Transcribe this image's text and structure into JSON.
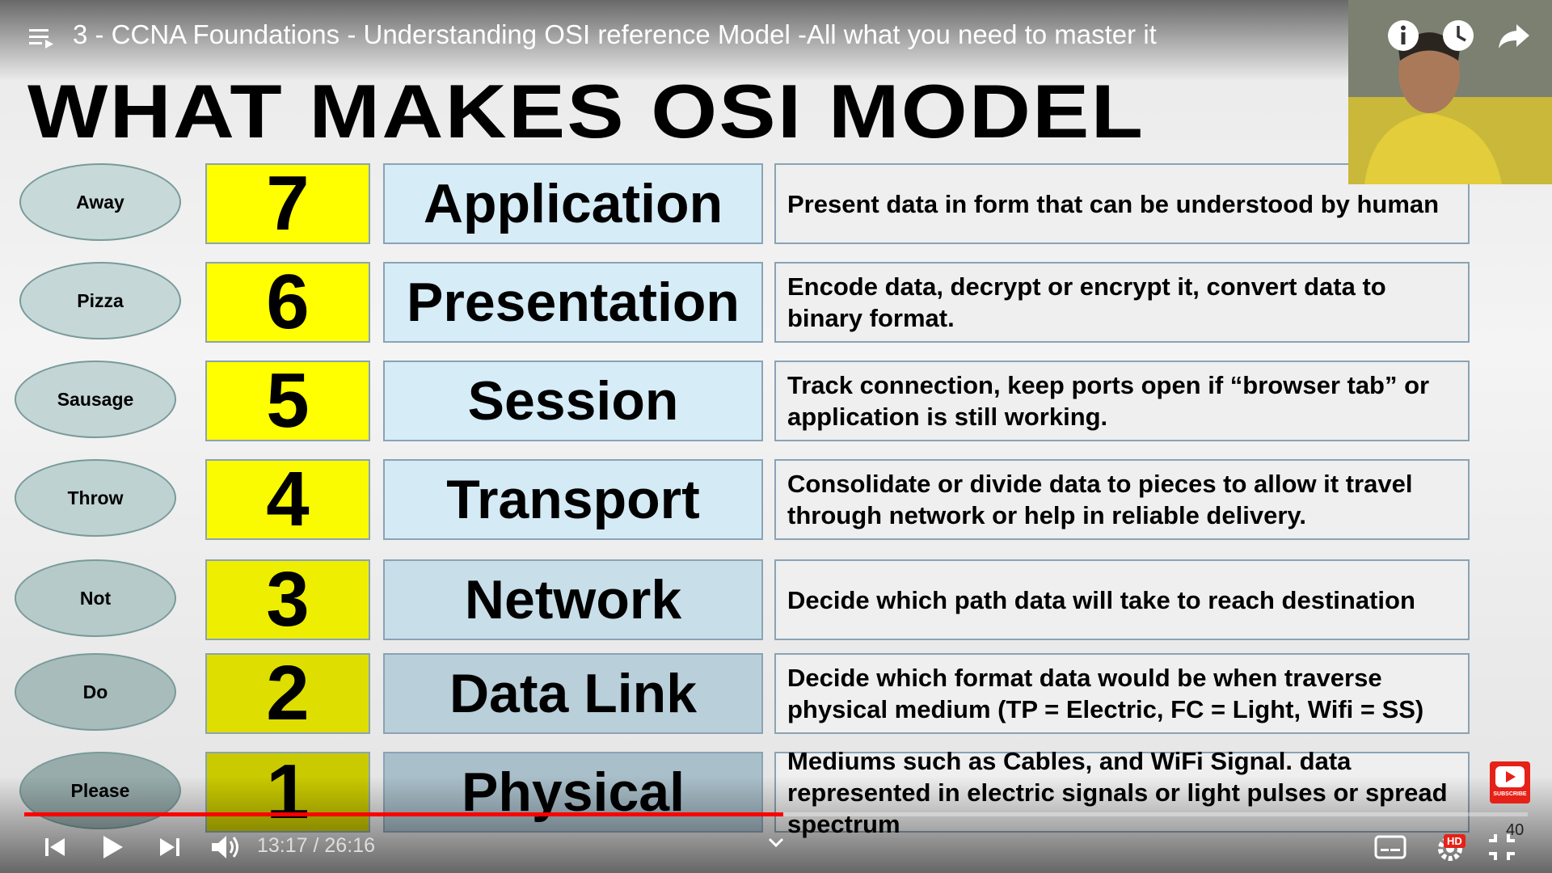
{
  "video": {
    "title": "3 - CCNA Foundations - Understanding OSI reference Model -All what you need to master it",
    "time_current": "13:17",
    "time_separator": " / ",
    "time_total": "26:16",
    "progress_fraction": 0.505,
    "counter": "40",
    "hd_badge": "HD",
    "subscribe_label": "SUBSCRIBE"
  },
  "slide": {
    "heading": "WHAT MAKES OSI MODEL",
    "layers": [
      {
        "mnemonic": "Away",
        "number": "7",
        "name": "Application",
        "description": "Present data in form that can be understood by human",
        "num_color": "#ffff00",
        "name_color": "#d6ecf7",
        "mnem_color": "#c7d9d9"
      },
      {
        "mnemonic": "Pizza",
        "number": "6",
        "name": "Presentation",
        "description": "Encode data, decrypt or encrypt it, convert data to binary format.",
        "num_color": "#ffff00",
        "name_color": "#d6ecf7",
        "mnem_color": "#c5d7d7"
      },
      {
        "mnemonic": "Sausage",
        "number": "5",
        "name": "Session",
        "description": "Track connection, keep ports open if “browser tab” or application is still working.",
        "num_color": "#ffff00",
        "name_color": "#d6ecf7",
        "mnem_color": "#c3d5d5"
      },
      {
        "mnemonic": "Throw",
        "number": "4",
        "name": "Transport",
        "description": "Consolidate or divide data to pieces to allow it travel through network or help in reliable delivery.",
        "num_color": "#fafa00",
        "name_color": "#d4eaf5",
        "mnem_color": "#bfd2d2"
      },
      {
        "mnemonic": "Not",
        "number": "3",
        "name": "Network",
        "description": "Decide which path data will take to reach destination",
        "num_color": "#eeee00",
        "name_color": "#c8dfea",
        "mnem_color": "#b6caca"
      },
      {
        "mnemonic": "Do",
        "number": "2",
        "name": "Data Link",
        "description": "Decide which format data would be when traverse physical medium (TP = Electric, FC = Light, Wifi = SS)",
        "num_color": "#dede00",
        "name_color": "#b9cfda",
        "mnem_color": "#a8bcbc"
      },
      {
        "mnemonic": "Please",
        "number": "1",
        "name": "Physical",
        "description": "Mediums such as Cables, and WiFi Signal. data represented in electric signals or light pulses or spread spectrum",
        "num_color": "#caca00",
        "name_color": "#a9bfca",
        "mnem_color": "#98acac"
      }
    ]
  },
  "icons": {
    "menu": "playlist-menu-icon",
    "info": "info-icon",
    "watch_later": "clock-icon",
    "share": "share-arrow-icon",
    "prev": "skip-previous-icon",
    "play": "play-icon",
    "next": "skip-next-icon",
    "volume": "volume-icon",
    "captions": "subtitles-icon",
    "settings": "gear-icon",
    "fullscreen_exit": "fullscreen-exit-icon",
    "chevron": "chevron-down-icon"
  }
}
